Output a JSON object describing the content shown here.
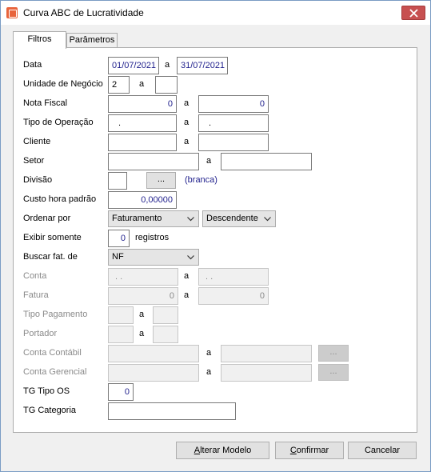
{
  "window": {
    "title": "Curva ABC de Lucratividade"
  },
  "tabs": [
    {
      "label": "Filtros"
    },
    {
      "label": "Parâmetros"
    }
  ],
  "labels": {
    "data": "Data",
    "unidade": "Unidade de Negócio",
    "nota": "Nota Fiscal",
    "tipo_op": "Tipo de Operação",
    "cliente": "Cliente",
    "setor": "Setor",
    "divisao": "Divisão",
    "custo": "Custo hora padrão",
    "ordenar": "Ordenar por",
    "exibir": "Exibir somente",
    "registros": "registros",
    "buscar": "Buscar fat. de",
    "conta": "Conta",
    "fatura": "Fatura",
    "tipo_pag": "Tipo Pagamento",
    "portador": "Portador",
    "conta_cont": "Conta Contábil",
    "conta_ger": "Conta Gerencial",
    "tg_tipo_os": "TG Tipo OS",
    "tg_categoria": "TG Categoria",
    "a": "a"
  },
  "fields": {
    "data_ini": "01/07/2021",
    "data_fim": "31/07/2021",
    "unidade_ini": "2",
    "unidade_fim": "",
    "nota_ini": "0",
    "nota_fim": "0",
    "tipo_op_ini": ".",
    "tipo_op_fim": ".",
    "cliente_ini": "",
    "cliente_fim": "",
    "setor_ini": "",
    "setor_fim": "",
    "divisao": "",
    "divisao_btn": "...",
    "divisao_desc": "(branca)",
    "custo": "0,00000",
    "ordenar_por": "Faturamento",
    "ordem": "Descendente",
    "exibir": "0",
    "buscar": "NF",
    "conta_ini": ". .",
    "conta_fim": ". .",
    "fatura_ini": "0",
    "fatura_fim": "0",
    "tipo_pag_ini": "",
    "tipo_pag_fim": "",
    "portador_ini": "",
    "portador_fim": "",
    "conta_cont_ini": "",
    "conta_cont_fim": "",
    "conta_cont_btn": "...",
    "conta_ger_ini": "",
    "conta_ger_fim": "",
    "conta_ger_btn": "...",
    "tg_tipo_os": "0",
    "tg_categoria": ""
  },
  "buttons": {
    "alterar_prefix": "A",
    "alterar_rest": "lterar Modelo",
    "confirmar_prefix": "C",
    "confirmar_rest": "onfirmar",
    "cancelar": "Cancelar"
  }
}
